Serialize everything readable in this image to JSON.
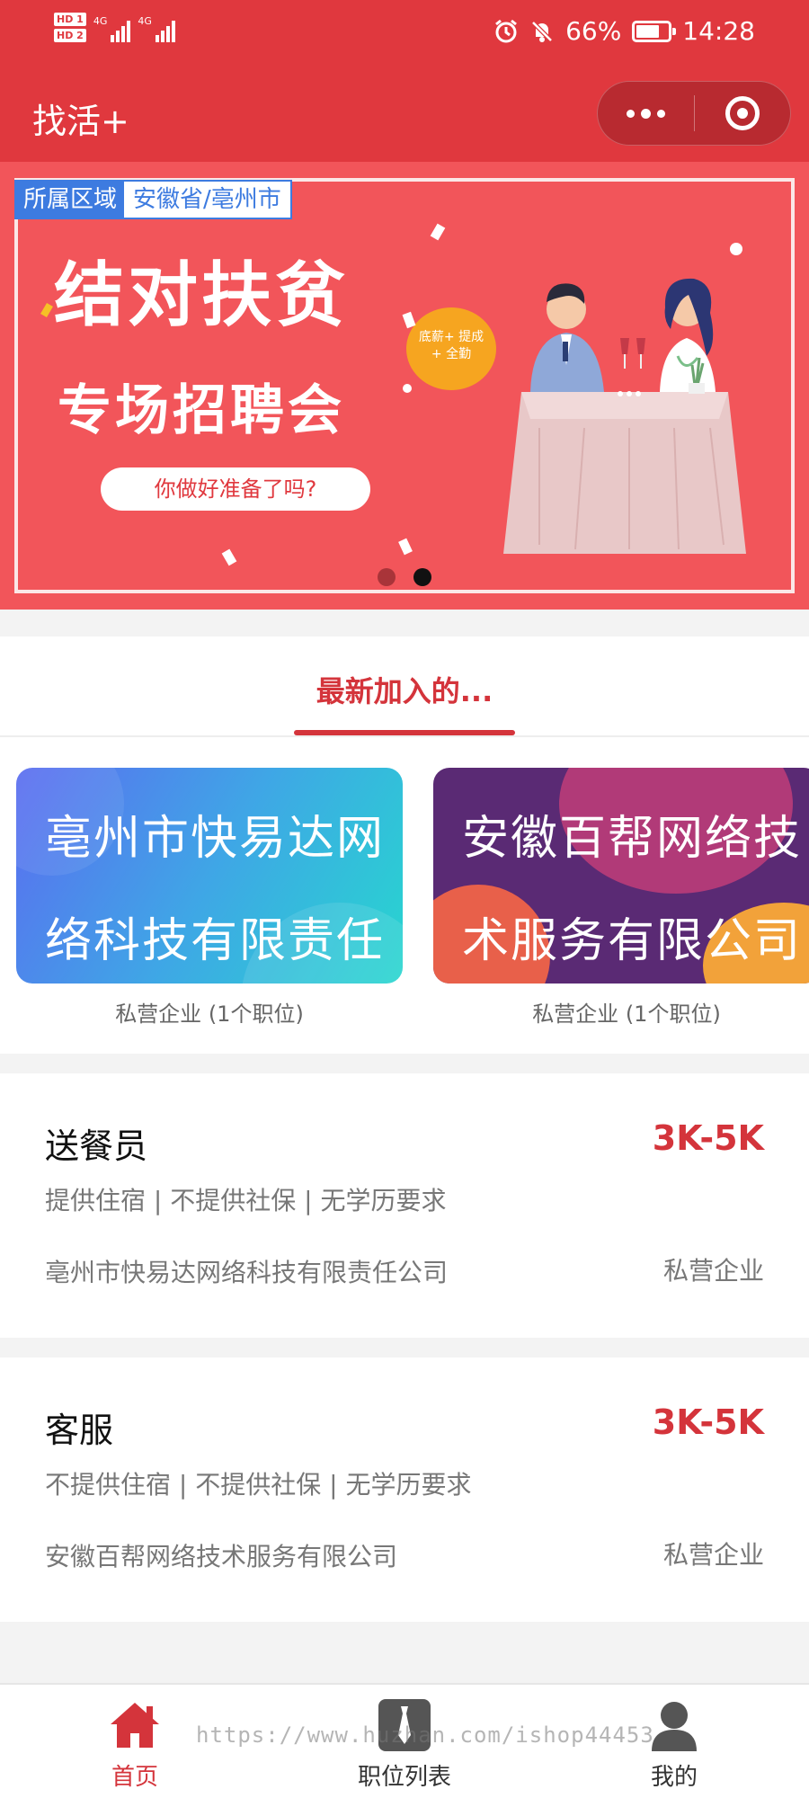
{
  "status_bar": {
    "hd1": "HD 1",
    "hd2": "HD 2",
    "net1": "4G",
    "net2": "4G",
    "battery_pct": "66%",
    "battery_level": 0.66,
    "time": "14:28",
    "icons": [
      "alarm-icon",
      "bell-off-icon",
      "battery-charging-icon"
    ]
  },
  "nav": {
    "title": "找活+"
  },
  "banner": {
    "region_label": "所属区域",
    "region_value": "安徽省/亳州市",
    "title_line1": "结对扶贫",
    "title_line2": "专场招聘会",
    "pill": "你做好准备了吗?",
    "bubble_line1": "底薪+ 提成",
    "bubble_line2": "+ 全勤",
    "dots_total": 2,
    "dot_active": 2,
    "bg_color": "#f2555a"
  },
  "section": {
    "title": "最新加入的..."
  },
  "companies": [
    {
      "name": "亳州市快易达网络科技有限责任",
      "meta": "私营企业 (1个职位)"
    },
    {
      "name": "安徽百帮网络技术服务有限公司",
      "meta": "私营企业 (1个职位)"
    }
  ],
  "jobs": [
    {
      "title": "送餐员",
      "salary": "3K-5K",
      "tags": "提供住宿 | 不提供社保 | 无学历要求",
      "company": "亳州市快易达网络科技有限责任公司",
      "type": "私营企业"
    },
    {
      "title": "客服",
      "salary": "3K-5K",
      "tags": "不提供住宿 | 不提供社保 | 无学历要求",
      "company": "安徽百帮网络技术服务有限公司",
      "type": "私营企业"
    }
  ],
  "tabbar": {
    "items": [
      {
        "label": "首页",
        "icon": "home-icon",
        "active": true
      },
      {
        "label": "职位列表",
        "icon": "tie-icon",
        "active": false
      },
      {
        "label": "我的",
        "icon": "user-icon",
        "active": false
      }
    ]
  },
  "watermark": "https://www.huzhan.com/ishop44453",
  "colors": {
    "primary": "#e0383e",
    "accent_text": "#d4343b",
    "region_blue": "#3d7be0"
  }
}
